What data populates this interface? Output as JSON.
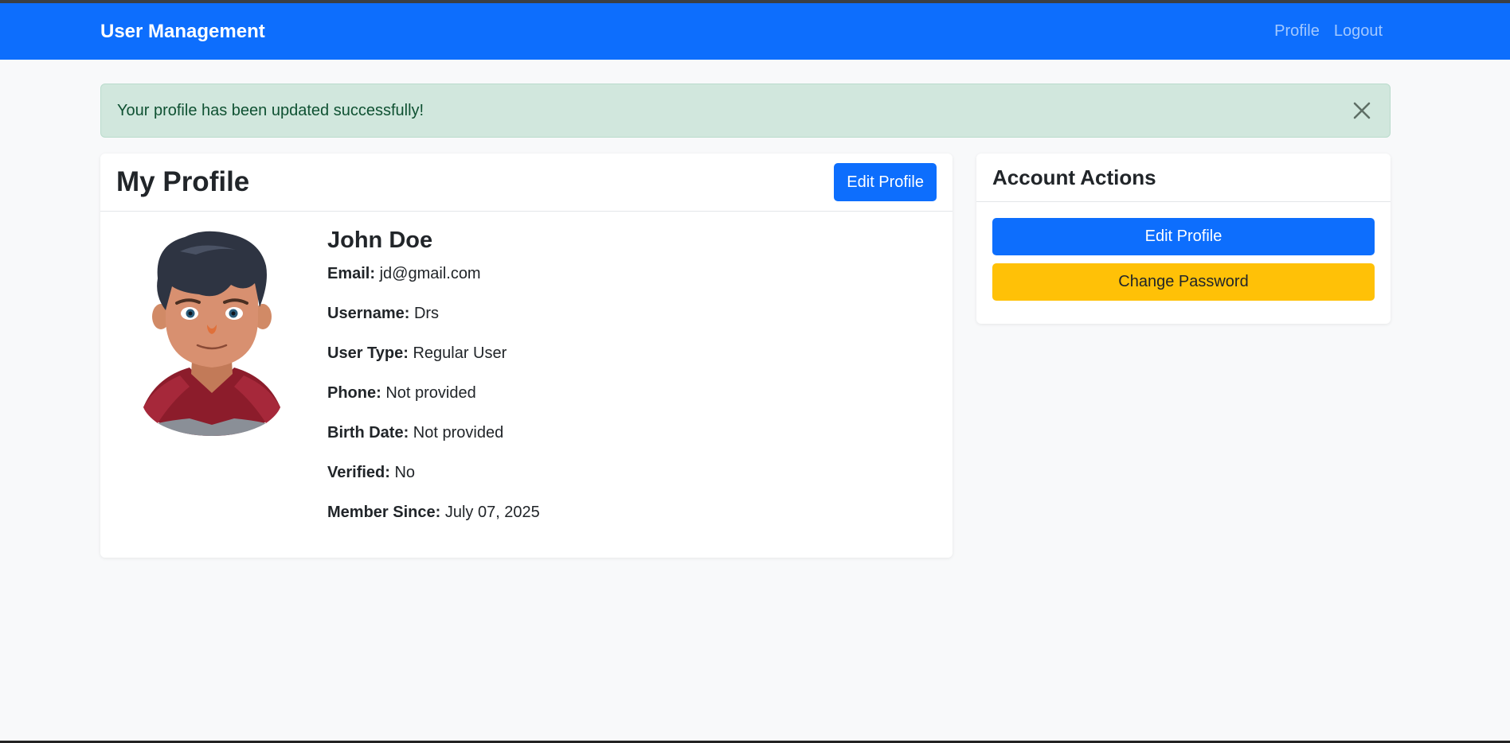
{
  "navbar": {
    "brand": "User Management",
    "links": [
      "Profile",
      "Logout"
    ]
  },
  "alert": {
    "message": "Your profile has been updated successfully!",
    "close_icon": "close-icon"
  },
  "profile_card": {
    "title": "My Profile",
    "edit_button": "Edit Profile",
    "avatar_icon": "cartoon-avatar-icon",
    "name": "John Doe",
    "fields": [
      {
        "label": "Email:",
        "value": "jd@gmail.com"
      },
      {
        "label": "Username:",
        "value": "Drs"
      },
      {
        "label": "User Type:",
        "value": "Regular User"
      },
      {
        "label": "Phone:",
        "value": "Not provided"
      },
      {
        "label": "Birth Date:",
        "value": "Not provided"
      },
      {
        "label": "Verified:",
        "value": "No"
      },
      {
        "label": "Member Since:",
        "value": "July 07, 2025"
      }
    ]
  },
  "actions_card": {
    "title": "Account Actions",
    "edit_button": "Edit Profile",
    "change_password_button": "Change Password"
  },
  "colors": {
    "primary": "#0d6efd",
    "warning": "#ffc107",
    "success_bg": "#d1e7dd",
    "success_text": "#0f5132",
    "page_bg": "#f8f9fa"
  }
}
